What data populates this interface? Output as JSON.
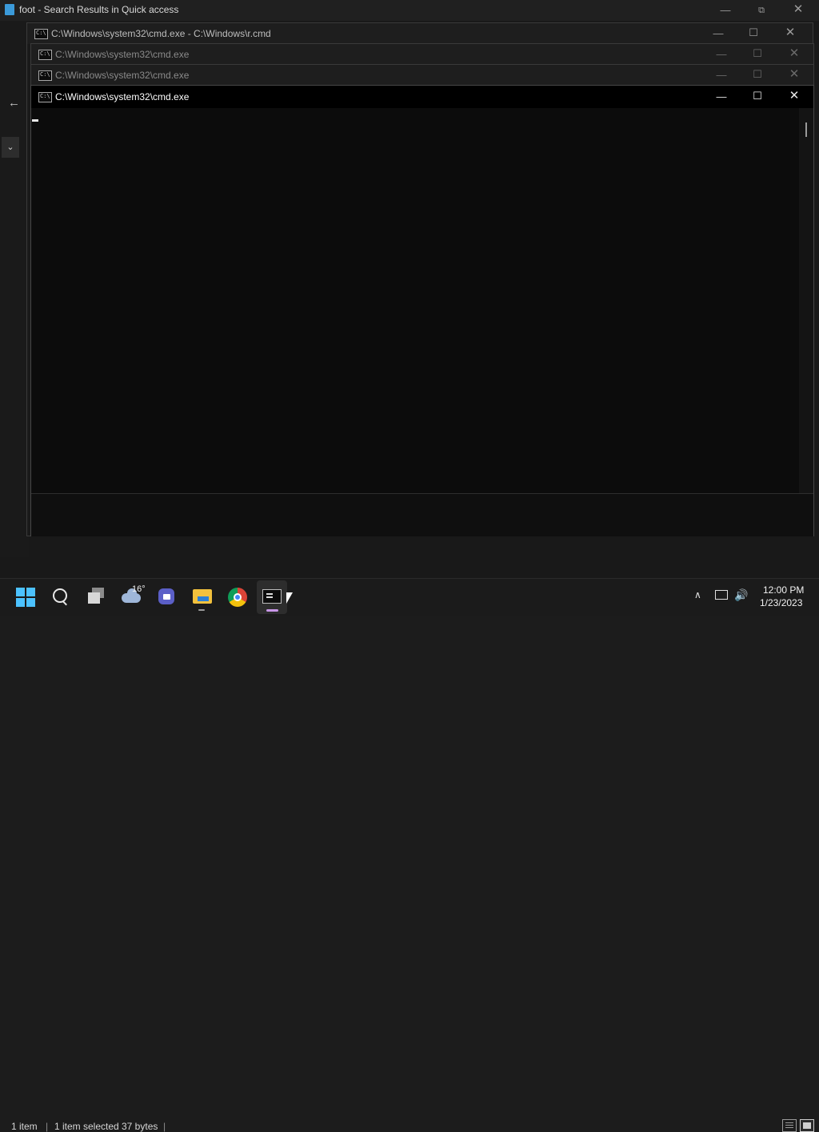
{
  "explorer": {
    "title": "foot - Search Results in Quick access",
    "status": {
      "item_count": "1 item",
      "selected": "1 item selected",
      "size": "37 bytes"
    },
    "separator": "|"
  },
  "window_controls": {
    "minimize": "—",
    "maximize": "☐",
    "restore": "⧉",
    "close": "✕"
  },
  "cmd_windows": [
    {
      "title": "C:\\Windows\\system32\\cmd.exe - C:\\Windows\\r.cmd",
      "title_color": "#bdbdbd"
    },
    {
      "title": "C:\\Windows\\system32\\cmd.exe",
      "title_color": "#8a8a8a"
    },
    {
      "title": "C:\\Windows\\system32\\cmd.exe",
      "title_color": "#8a8a8a"
    },
    {
      "title": "C:\\Windows\\system32\\cmd.exe",
      "title_color": "#ffffff"
    }
  ],
  "taskbar": {
    "weather_temp": "16°",
    "clock_time": "12:00 PM",
    "clock_date": "1/23/2023",
    "tray_chevron": "∧",
    "volume_glyph": "🔊",
    "icons": [
      "windows-start-icon",
      "search-icon",
      "task-view-icon",
      "weather-icon",
      "meet-icon",
      "file-explorer-icon",
      "chrome-icon",
      "terminal-icon"
    ],
    "accent_colors": {
      "start": "#4cc2ff",
      "terminal_running": "#c896e8"
    }
  }
}
